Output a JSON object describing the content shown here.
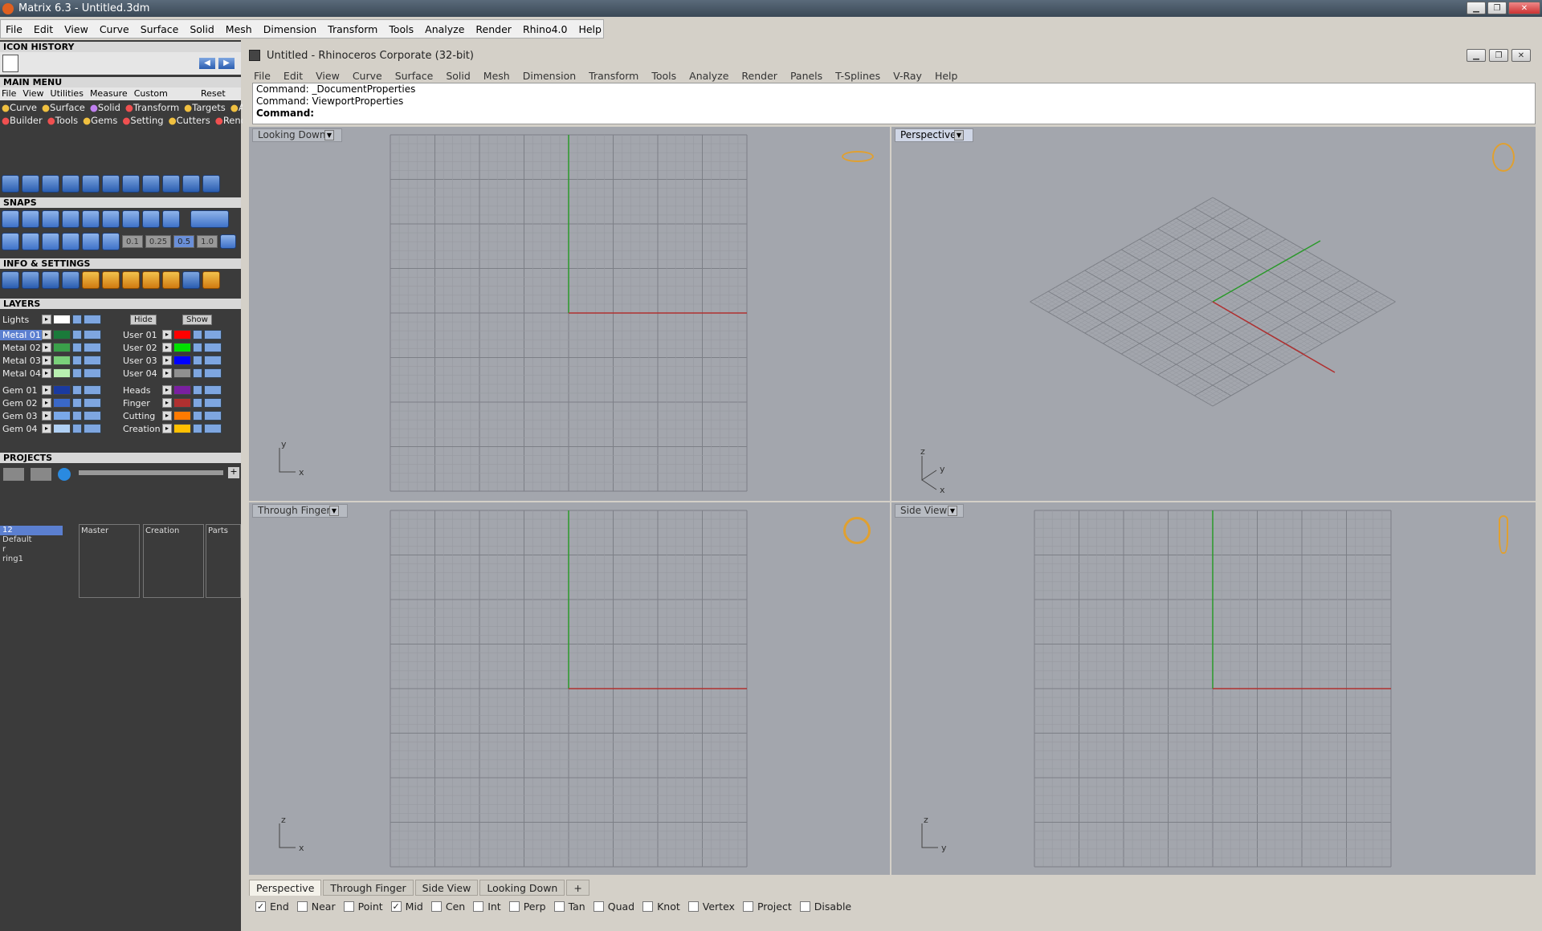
{
  "app": {
    "title": "Matrix 6.3 - Untitled.3dm"
  },
  "outer_menu": [
    "File",
    "Edit",
    "View",
    "Curve",
    "Surface",
    "Solid",
    "Mesh",
    "Dimension",
    "Transform",
    "Tools",
    "Analyze",
    "Render",
    "Rhino4.0",
    "Help"
  ],
  "left": {
    "icon_history": "ICON HISTORY",
    "main_menu": "MAIN MENU",
    "main_tabs": [
      "File",
      "View",
      "Utilities",
      "Measure",
      "Custom"
    ],
    "reset": "Reset",
    "cats1": [
      "Curve",
      "Surface",
      "Solid",
      "Transform",
      "Targets",
      "Art"
    ],
    "cats2": [
      "Builder",
      "Tools",
      "Gems",
      "Setting",
      "Cutters",
      "Render"
    ],
    "snaps": "SNAPS",
    "snap_vals": [
      "0.1",
      "0.25",
      "0.5",
      "1.0"
    ],
    "info": "INFO & SETTINGS",
    "layers": "LAYERS",
    "lights": "Lights",
    "hide": "Hide",
    "show": "Show",
    "left_layers": [
      {
        "name": "Metal 01",
        "color": "#1a7a3a"
      },
      {
        "name": "Metal 02",
        "color": "#3aa04a"
      },
      {
        "name": "Metal 03",
        "color": "#7ad07a"
      },
      {
        "name": "Metal 04",
        "color": "#b8f0b0"
      },
      {
        "name": "Gem 01",
        "color": "#1a3aa0"
      },
      {
        "name": "Gem 02",
        "color": "#3a68c8"
      },
      {
        "name": "Gem 03",
        "color": "#7aa8e8"
      },
      {
        "name": "Gem 04",
        "color": "#b0d0f4"
      }
    ],
    "right_layers": [
      {
        "name": "User 01",
        "color": "#ff0000"
      },
      {
        "name": "User 02",
        "color": "#00e000"
      },
      {
        "name": "User 03",
        "color": "#0000ff"
      },
      {
        "name": "User 04",
        "color": "#909090"
      },
      {
        "name": "Heads",
        "color": "#7a20a0"
      },
      {
        "name": "Finger",
        "color": "#b03030"
      },
      {
        "name": "Cutting",
        "color": "#ff7a00"
      },
      {
        "name": "Creation",
        "color": "#ffc000"
      }
    ],
    "projects": "PROJECTS",
    "project_list": [
      "12",
      "Default",
      "r",
      "ring1"
    ],
    "project_cols": [
      "Master",
      "Creation",
      "Parts"
    ]
  },
  "rhino": {
    "title": "Untitled - Rhinoceros Corporate (32-bit)",
    "menu": [
      "File",
      "Edit",
      "View",
      "Curve",
      "Surface",
      "Solid",
      "Mesh",
      "Dimension",
      "Transform",
      "Tools",
      "Analyze",
      "Render",
      "Panels",
      "T-Splines",
      "V-Ray",
      "Help"
    ],
    "cmd1": "Command: _DocumentProperties",
    "cmd2": "Command: ViewportProperties",
    "cmd3": "Command:"
  },
  "viewports": {
    "top_left": "Looking Down",
    "top_right": "Perspective",
    "bottom_left": "Through Finger",
    "bottom_right": "Side View"
  },
  "tabs": [
    "Perspective",
    "Through Finger",
    "Side View",
    "Looking Down"
  ],
  "osnaps": [
    {
      "label": "End",
      "checked": true
    },
    {
      "label": "Near",
      "checked": false
    },
    {
      "label": "Point",
      "checked": false
    },
    {
      "label": "Mid",
      "checked": true
    },
    {
      "label": "Cen",
      "checked": false
    },
    {
      "label": "Int",
      "checked": false
    },
    {
      "label": "Perp",
      "checked": false
    },
    {
      "label": "Tan",
      "checked": false
    },
    {
      "label": "Quad",
      "checked": false
    },
    {
      "label": "Knot",
      "checked": false
    },
    {
      "label": "Vertex",
      "checked": false
    },
    {
      "label": "Project",
      "checked": false
    },
    {
      "label": "Disable",
      "checked": false
    }
  ]
}
